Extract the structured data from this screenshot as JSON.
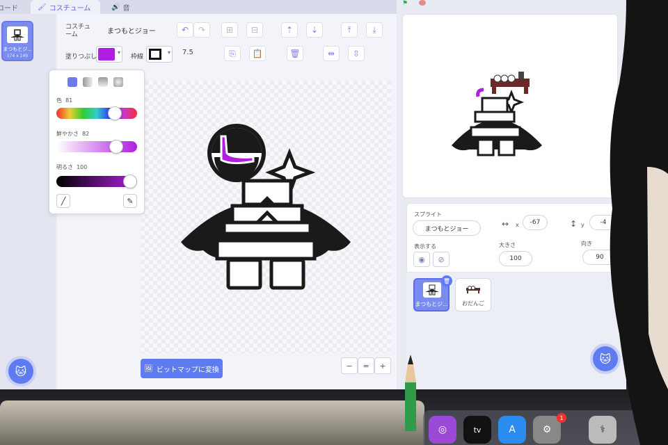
{
  "tabs": {
    "code": "コード",
    "costumes": "コスチューム",
    "sounds": "音"
  },
  "costume_list": [
    {
      "name": "まつもとジ...",
      "size": "174 x 149"
    }
  ],
  "editor": {
    "costume_label": "コスチューム",
    "costume_name": "まつもとジョー",
    "fill_label": "塗りつぶし",
    "outline_label": "枠線",
    "stroke_width": "7.5",
    "convert_button": "ビットマップに変換",
    "zoom_out": "−",
    "zoom_reset": "=",
    "zoom_in": "+"
  },
  "color_picker": {
    "hue_label": "色",
    "hue_value": "81",
    "sat_label": "鮮やかさ",
    "sat_value": "82",
    "bright_label": "明るさ",
    "bright_value": "100"
  },
  "sprite_info": {
    "sprite_label": "スプライト",
    "sprite_name": "まつもとジョー",
    "x_label": "x",
    "x_value": "-67",
    "y_label": "y",
    "y_value": "-4",
    "show_label": "表示する",
    "size_label": "大きさ",
    "size_value": "100",
    "direction_label": "向き",
    "direction_value": "90"
  },
  "sprites": [
    {
      "name": "まつもとジ..."
    },
    {
      "name": "おだんご"
    }
  ],
  "colors": {
    "fill": "#b01ee0",
    "accent": "#5f7bf2",
    "stroke": "#111111"
  },
  "dock": {
    "appletv_label": "tv",
    "badge": "1"
  }
}
